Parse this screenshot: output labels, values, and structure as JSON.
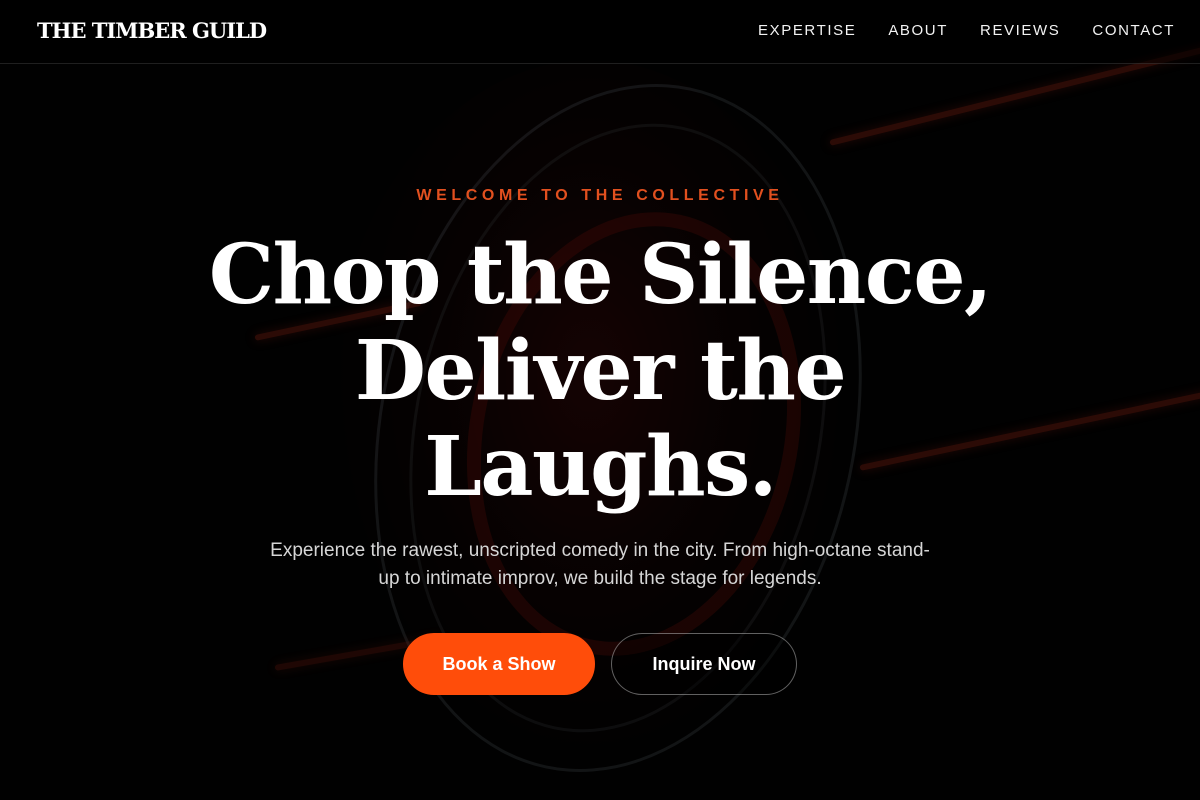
{
  "brand": {
    "name": "THE TIMBER GUILD"
  },
  "nav": {
    "items": [
      {
        "label": "EXPERTISE"
      },
      {
        "label": "ABOUT"
      },
      {
        "label": "REVIEWS"
      },
      {
        "label": "CONTACT"
      }
    ]
  },
  "hero": {
    "eyebrow": "WELCOME TO THE COLLECTIVE",
    "headline_lines": [
      "Chop the Silence,",
      "Deliver the",
      "Laughs."
    ],
    "subtext": "Experience the rawest, unscripted comedy in the city. From high-octane stand-up to intimate improv, we build the stage for legends.",
    "primary_cta": "Book a Show",
    "secondary_cta": "Inquire Now"
  },
  "colors": {
    "accent": "#ff4d0a",
    "eyebrow": "#e2501f",
    "background": "#000000"
  }
}
